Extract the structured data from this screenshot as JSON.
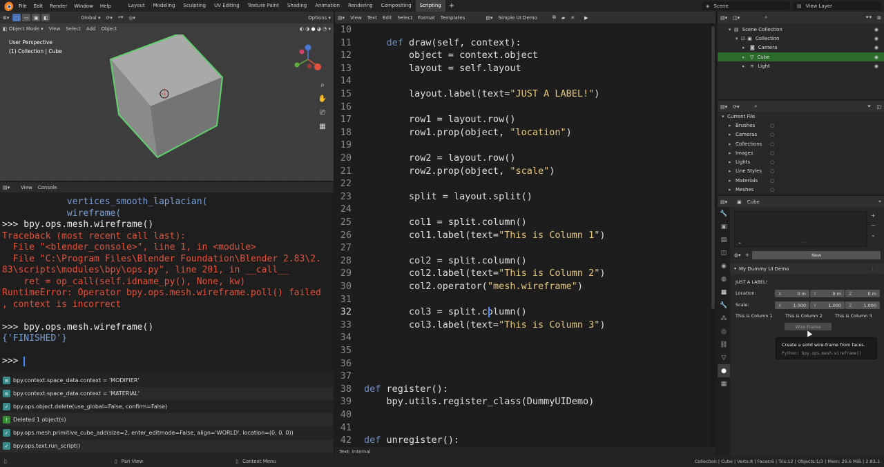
{
  "menu": [
    "File",
    "Edit",
    "Render",
    "Window",
    "Help"
  ],
  "workspaces": [
    "Layout",
    "Modeling",
    "Sculpting",
    "UV Editing",
    "Texture Paint",
    "Shading",
    "Animation",
    "Rendering",
    "Compositing",
    "Scripting"
  ],
  "active_workspace": "Scripting",
  "plus": "+",
  "scene": "Scene",
  "view_layer": "View Layer",
  "viewport": {
    "orientation": "Global",
    "options": "Options",
    "mode": "Object Mode",
    "menus": [
      "View",
      "Select",
      "Add",
      "Object"
    ],
    "overlay_title": "User Perspective",
    "overlay_sub": "(1) Collection | Cube"
  },
  "console": {
    "menus": [
      "View",
      "Console"
    ],
    "lines": [
      {
        "t": "            vertices_smooth_laplacian(",
        "c": "#7aa0d8"
      },
      {
        "t": "            wireframe(",
        "c": "#7aa0d8"
      },
      {
        "t": ">>> bpy.ops.mesh.wireframe()",
        "c": "#e8e8e8"
      },
      {
        "t": "Traceback (most recent call last):",
        "c": "#e2533a"
      },
      {
        "t": "  File \"<blender_console>\", line 1, in <module>",
        "c": "#e2533a"
      },
      {
        "t": "  File \"C:\\Program Files\\Blender Foundation\\Blender 2.83\\2.",
        "c": "#e2533a"
      },
      {
        "t": "83\\scripts\\modules\\bpy\\ops.py\", line 201, in __call__",
        "c": "#e2533a"
      },
      {
        "t": "    ret = op_call(self.idname_py(), None, kw)",
        "c": "#e2533a"
      },
      {
        "t": "RuntimeError: Operator bpy.ops.mesh.wireframe.poll() failed",
        "c": "#e2533a"
      },
      {
        "t": ", context is incorrect",
        "c": "#e2533a"
      },
      {
        "t": "",
        "c": "#e8e8e8"
      },
      {
        "t": ">>> bpy.ops.mesh.wireframe()",
        "c": "#e8e8e8"
      },
      {
        "t": "{'FINISHED'}",
        "c": "#7aa0d8"
      },
      {
        "t": "",
        "c": "#e8e8e8"
      },
      {
        "t": ">>> ",
        "c": "#e8e8e8"
      }
    ]
  },
  "info": [
    {
      "icon": "≡",
      "color": "#3a8a8a",
      "text": "bpy.context.space_data.context = 'MODIFIER'"
    },
    {
      "icon": "≡",
      "color": "#3a8a8a",
      "text": "bpy.context.space_data.context = 'MATERIAL'"
    },
    {
      "icon": "✓",
      "color": "#3a8a8a",
      "text": "bpy.ops.object.delete(use_global=False, confirm=False)"
    },
    {
      "icon": "!",
      "color": "#3a8a3a",
      "text": "Deleted 1 object(s)"
    },
    {
      "icon": "✓",
      "color": "#3a8a8a",
      "text": "bpy.ops.mesh.primitive_cube_add(size=2, enter_editmode=False, align='WORLD', location=(0, 0, 0))"
    },
    {
      "icon": "✓",
      "color": "#3a8a8a",
      "text": "bpy.ops.text.run_script()"
    }
  ],
  "text_editor": {
    "menus": [
      "View",
      "Text",
      "Edit",
      "Select",
      "Format",
      "Templates"
    ],
    "file": "Simple UI Demo",
    "status": "Text: Internal"
  },
  "code": [
    {
      "n": "10",
      "h": []
    },
    {
      "n": "11",
      "h": [
        [
          "    ",
          ""
        ],
        [
          "def ",
          "kw"
        ],
        [
          "draw(self, context):",
          ""
        ]
      ]
    },
    {
      "n": "12",
      "h": [
        [
          "        object = context.object",
          ""
        ]
      ]
    },
    {
      "n": "13",
      "h": [
        [
          "        layout = self.layout",
          ""
        ]
      ]
    },
    {
      "n": "14",
      "h": []
    },
    {
      "n": "15",
      "h": [
        [
          "        layout.label(text=",
          ""
        ],
        [
          "\"JUST A LABEL!\"",
          "st"
        ],
        [
          ")",
          ""
        ]
      ]
    },
    {
      "n": "16",
      "h": []
    },
    {
      "n": "17",
      "h": [
        [
          "        row1 = layout.row()",
          ""
        ]
      ]
    },
    {
      "n": "18",
      "h": [
        [
          "        row1.prop(object, ",
          ""
        ],
        [
          "\"location\"",
          "st"
        ],
        [
          ")",
          ""
        ]
      ]
    },
    {
      "n": "19",
      "h": []
    },
    {
      "n": "20",
      "h": [
        [
          "        row2 = layout.row()",
          ""
        ]
      ]
    },
    {
      "n": "21",
      "h": [
        [
          "        row2.prop(object, ",
          ""
        ],
        [
          "\"scale\"",
          "st"
        ],
        [
          ")",
          ""
        ]
      ]
    },
    {
      "n": "22",
      "h": []
    },
    {
      "n": "23",
      "h": [
        [
          "        split = layout.split()",
          ""
        ]
      ]
    },
    {
      "n": "24",
      "h": []
    },
    {
      "n": "25",
      "h": [
        [
          "        col1 = split.column()",
          ""
        ]
      ]
    },
    {
      "n": "26",
      "h": [
        [
          "        col1.label(text=",
          ""
        ],
        [
          "\"This is Column 1\"",
          "st"
        ],
        [
          ")",
          ""
        ]
      ]
    },
    {
      "n": "27",
      "h": []
    },
    {
      "n": "28",
      "h": [
        [
          "        col2 = split.column()",
          ""
        ]
      ]
    },
    {
      "n": "29",
      "h": [
        [
          "        col2.label(text=",
          ""
        ],
        [
          "\"This is Column 2\"",
          "st"
        ],
        [
          ")",
          ""
        ]
      ]
    },
    {
      "n": "30",
      "h": [
        [
          "        col2.operator(",
          ""
        ],
        [
          "\"mesh.wireframe\"",
          "st"
        ],
        [
          ")",
          ""
        ]
      ]
    },
    {
      "n": "31",
      "h": []
    },
    {
      "n": "32",
      "h": [
        [
          "        col3 = split.column()",
          ""
        ]
      ],
      "cur": true
    },
    {
      "n": "33",
      "h": [
        [
          "        col3.label(text=",
          ""
        ],
        [
          "\"This is Column 3\"",
          "st"
        ],
        [
          ")",
          ""
        ]
      ]
    },
    {
      "n": "34",
      "h": []
    },
    {
      "n": "35",
      "h": []
    },
    {
      "n": "36",
      "h": []
    },
    {
      "n": "37",
      "h": []
    },
    {
      "n": "38",
      "h": [
        [
          "def ",
          "kw"
        ],
        [
          "register():",
          ""
        ]
      ]
    },
    {
      "n": "39",
      "h": [
        [
          "    bpy.utils.register_class(DummyUIDemo)",
          ""
        ]
      ]
    },
    {
      "n": "40",
      "h": []
    },
    {
      "n": "41",
      "h": []
    },
    {
      "n": "42",
      "h": [
        [
          "def ",
          "kw"
        ],
        [
          "unregister():",
          ""
        ]
      ]
    }
  ],
  "outliner": {
    "rows": [
      {
        "label": "Scene Collection",
        "indent": 0
      },
      {
        "label": "Collection",
        "indent": 1
      },
      {
        "label": "Camera",
        "indent": 2
      },
      {
        "label": "Cube",
        "indent": 2,
        "sel": true
      },
      {
        "label": "Light",
        "indent": 2
      }
    ]
  },
  "file_browser": {
    "root": "Current File",
    "items": [
      "Brushes",
      "Cameras",
      "Collections",
      "Images",
      "Lights",
      "Line Styles",
      "Materials",
      "Meshes"
    ]
  },
  "properties": {
    "object": "Cube",
    "new": "New",
    "panel": "My Dummy UI Demo",
    "label": "JUST A LABEL!",
    "location_label": "Location:",
    "scale_label": "Scale:",
    "loc": [
      {
        "axis": "X",
        "val": "0 m"
      },
      {
        "axis": "Y",
        "val": "0 m"
      },
      {
        "axis": "Z",
        "val": "0 m"
      }
    ],
    "scale": [
      {
        "axis": "X",
        "val": "1.000"
      },
      {
        "axis": "Y",
        "val": "1.000"
      },
      {
        "axis": "Z",
        "val": "1.000"
      }
    ],
    "columns": [
      "This is Column 1",
      "This is Column 2",
      "This is Column 3"
    ],
    "button": "Wire Frame",
    "tooltip": {
      "title": "Create a solid wire-frame from faces.",
      "python": "Python: bpy.ops.mesh.wireframe()"
    }
  },
  "status": {
    "pan": "Pan View",
    "context": "Context Menu",
    "right": "Collection | Cube | Verts:8 | Faces:6 | Tris:12 | Objects:1/3 | Mem: 29.6 MiB | 2.83.1"
  }
}
